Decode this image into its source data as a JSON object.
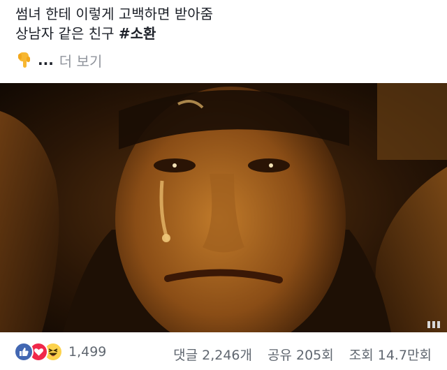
{
  "post": {
    "line1": "썸녀 한테 이렇게 고백하면 받아줌",
    "line2_prefix": "상남자 같은 친구 ",
    "hashtag": "#소환",
    "see_more_ellipsis": "...",
    "see_more_label": "더 보기",
    "see_more_icon": "backhand-index-pointing-down-icon"
  },
  "video": {
    "controls_icon": "video-quality-icon"
  },
  "footer": {
    "reaction_icons": [
      "like-icon",
      "love-icon",
      "haha-icon"
    ],
    "reaction_count": "1,499",
    "comments": "댓글 2,246개",
    "shares": "공유 205회",
    "views": "조회 14.7만회"
  },
  "colors": {
    "like": "#4267b2",
    "love": "#f0284a",
    "haha": "#fcd24c",
    "meta_text": "#606770",
    "see_more": "#90949c"
  }
}
